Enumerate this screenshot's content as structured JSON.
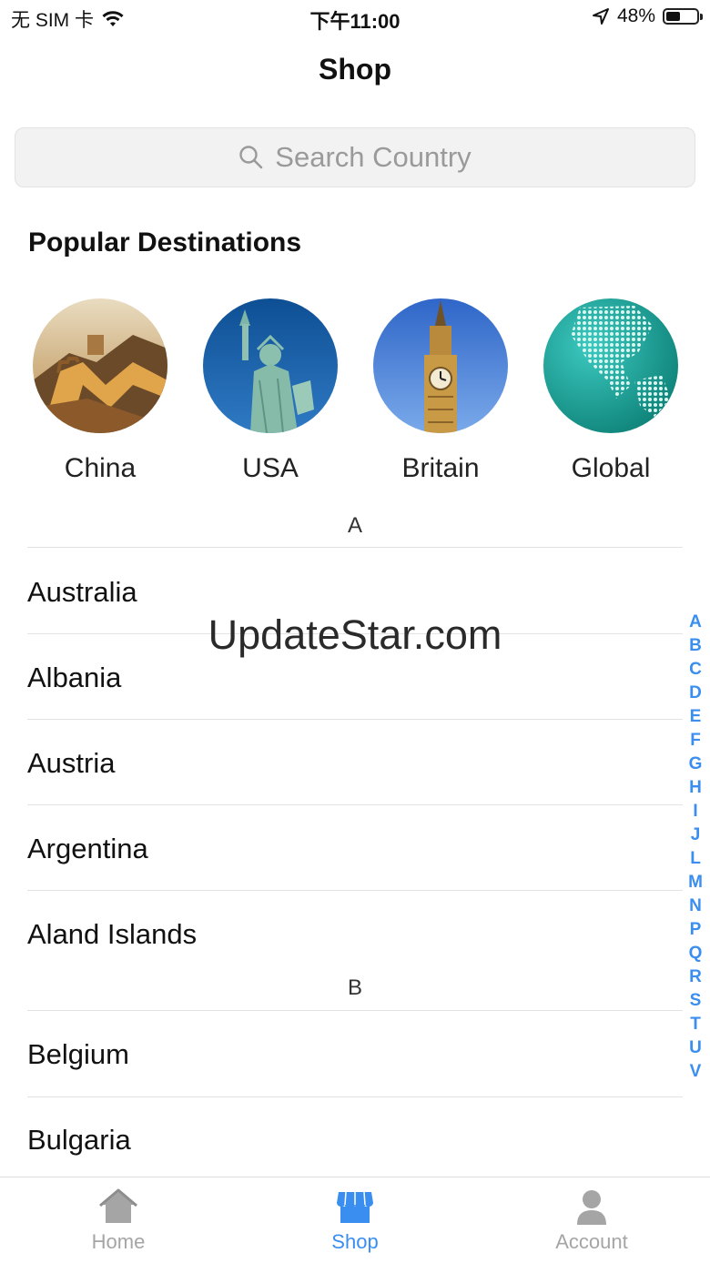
{
  "status_bar": {
    "carrier": "无 SIM 卡",
    "time": "下午11:00",
    "battery": "48%",
    "battery_level": 0.48
  },
  "nav": {
    "title": "Shop"
  },
  "search": {
    "placeholder": "Search Country"
  },
  "popular": {
    "title": "Popular Destinations",
    "items": [
      {
        "label": "China"
      },
      {
        "label": "USA"
      },
      {
        "label": "Britain"
      },
      {
        "label": "Global"
      }
    ]
  },
  "sections": [
    {
      "letter": "A",
      "countries": [
        "Australia",
        "Albania",
        "Austria",
        "Argentina",
        "Aland Islands"
      ]
    },
    {
      "letter": "B",
      "countries": [
        "Belgium",
        "Bulgaria"
      ]
    }
  ],
  "watermark": "UpdateStar.com",
  "index_letters": [
    "A",
    "B",
    "C",
    "D",
    "E",
    "F",
    "G",
    "H",
    "I",
    "J",
    "L",
    "M",
    "N",
    "P",
    "Q",
    "R",
    "S",
    "T",
    "U",
    "V"
  ],
  "tab_bar": {
    "home": "Home",
    "shop": "Shop",
    "account": "Account",
    "active_color": "#3a8ef0",
    "inactive_color": "#a5a5a5"
  }
}
